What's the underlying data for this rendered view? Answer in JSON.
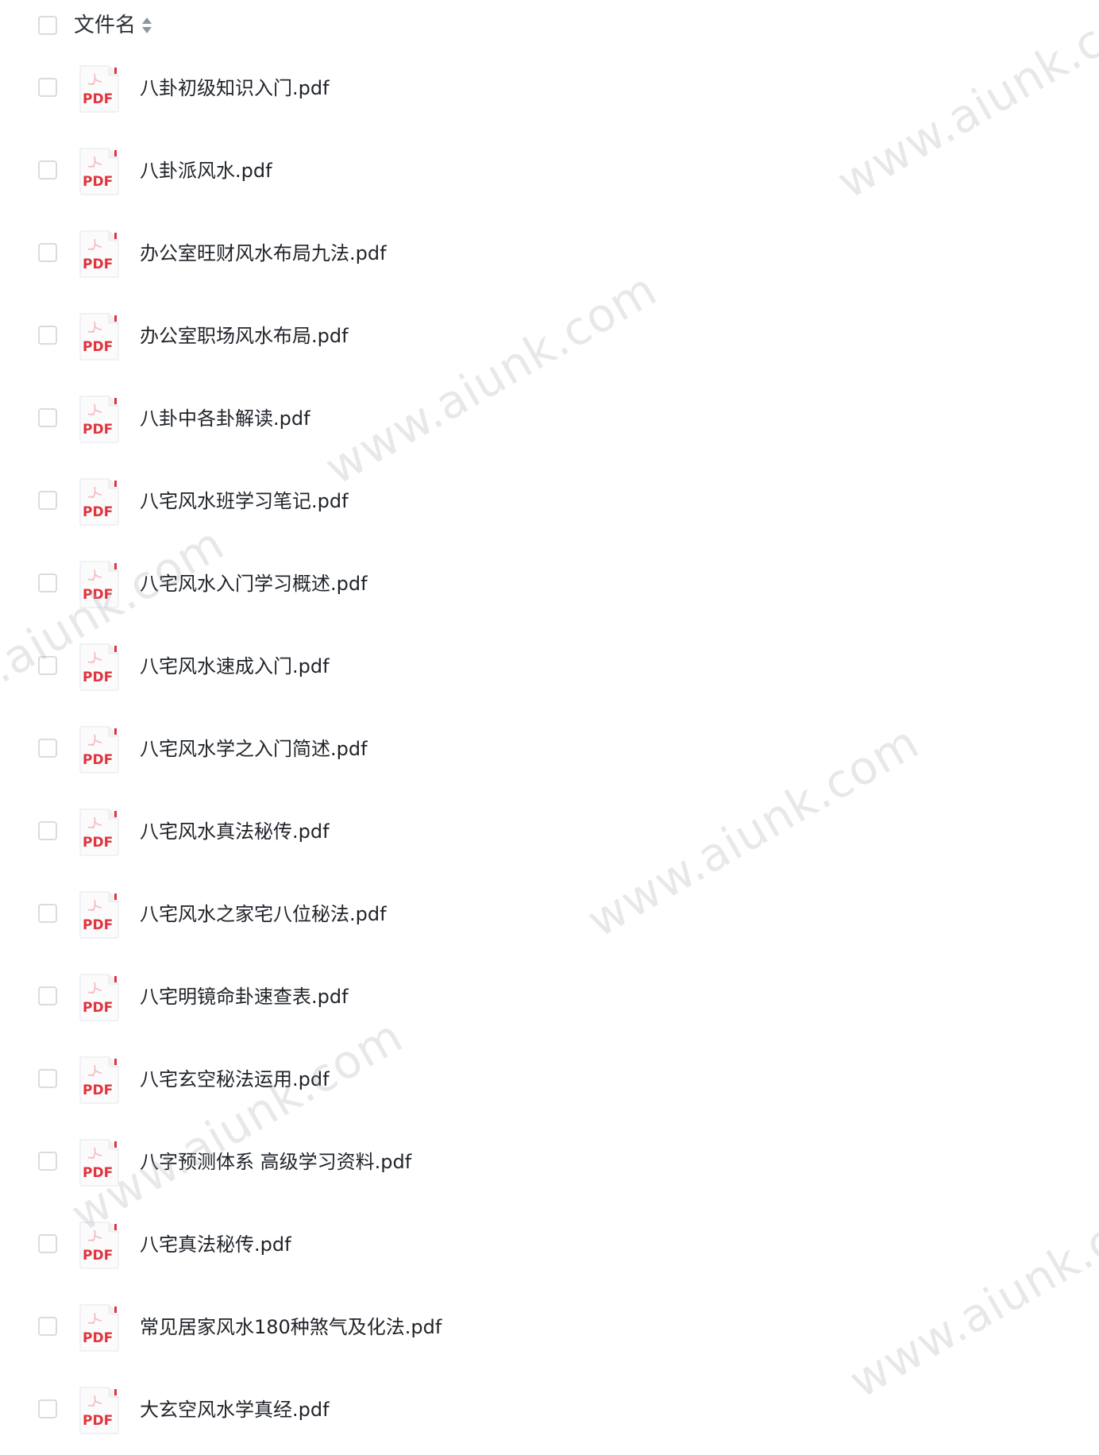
{
  "header": {
    "column_label": "文件名",
    "sort_icon": "sort-toggle-icon"
  },
  "file_icon": {
    "label": "PDF",
    "color": "#e0343d",
    "icon": "pdf-file-icon"
  },
  "files": [
    {
      "name": "八卦初级知识入门.pdf"
    },
    {
      "name": "八卦派风水.pdf"
    },
    {
      "name": "办公室旺财风水布局九法.pdf"
    },
    {
      "name": "办公室职场风水布局.pdf"
    },
    {
      "name": "八卦中各卦解读.pdf"
    },
    {
      "name": "八宅风水班学习笔记.pdf"
    },
    {
      "name": "八宅风水入门学习概述.pdf"
    },
    {
      "name": "八宅风水速成入门.pdf"
    },
    {
      "name": "八宅风水学之入门简述.pdf"
    },
    {
      "name": "八宅风水真法秘传.pdf"
    },
    {
      "name": "八宅风水之家宅八位秘法.pdf"
    },
    {
      "name": "八宅明镜命卦速查表.pdf"
    },
    {
      "name": "八宅玄空秘法运用.pdf"
    },
    {
      "name": "八字预测体系 高级学习资料.pdf"
    },
    {
      "name": "八宅真法秘传.pdf"
    },
    {
      "name": "常见居家风水180种煞气及化法.pdf"
    },
    {
      "name": "大玄空风水学真经.pdf"
    }
  ],
  "watermark": {
    "text": "www.aiunk.com"
  }
}
